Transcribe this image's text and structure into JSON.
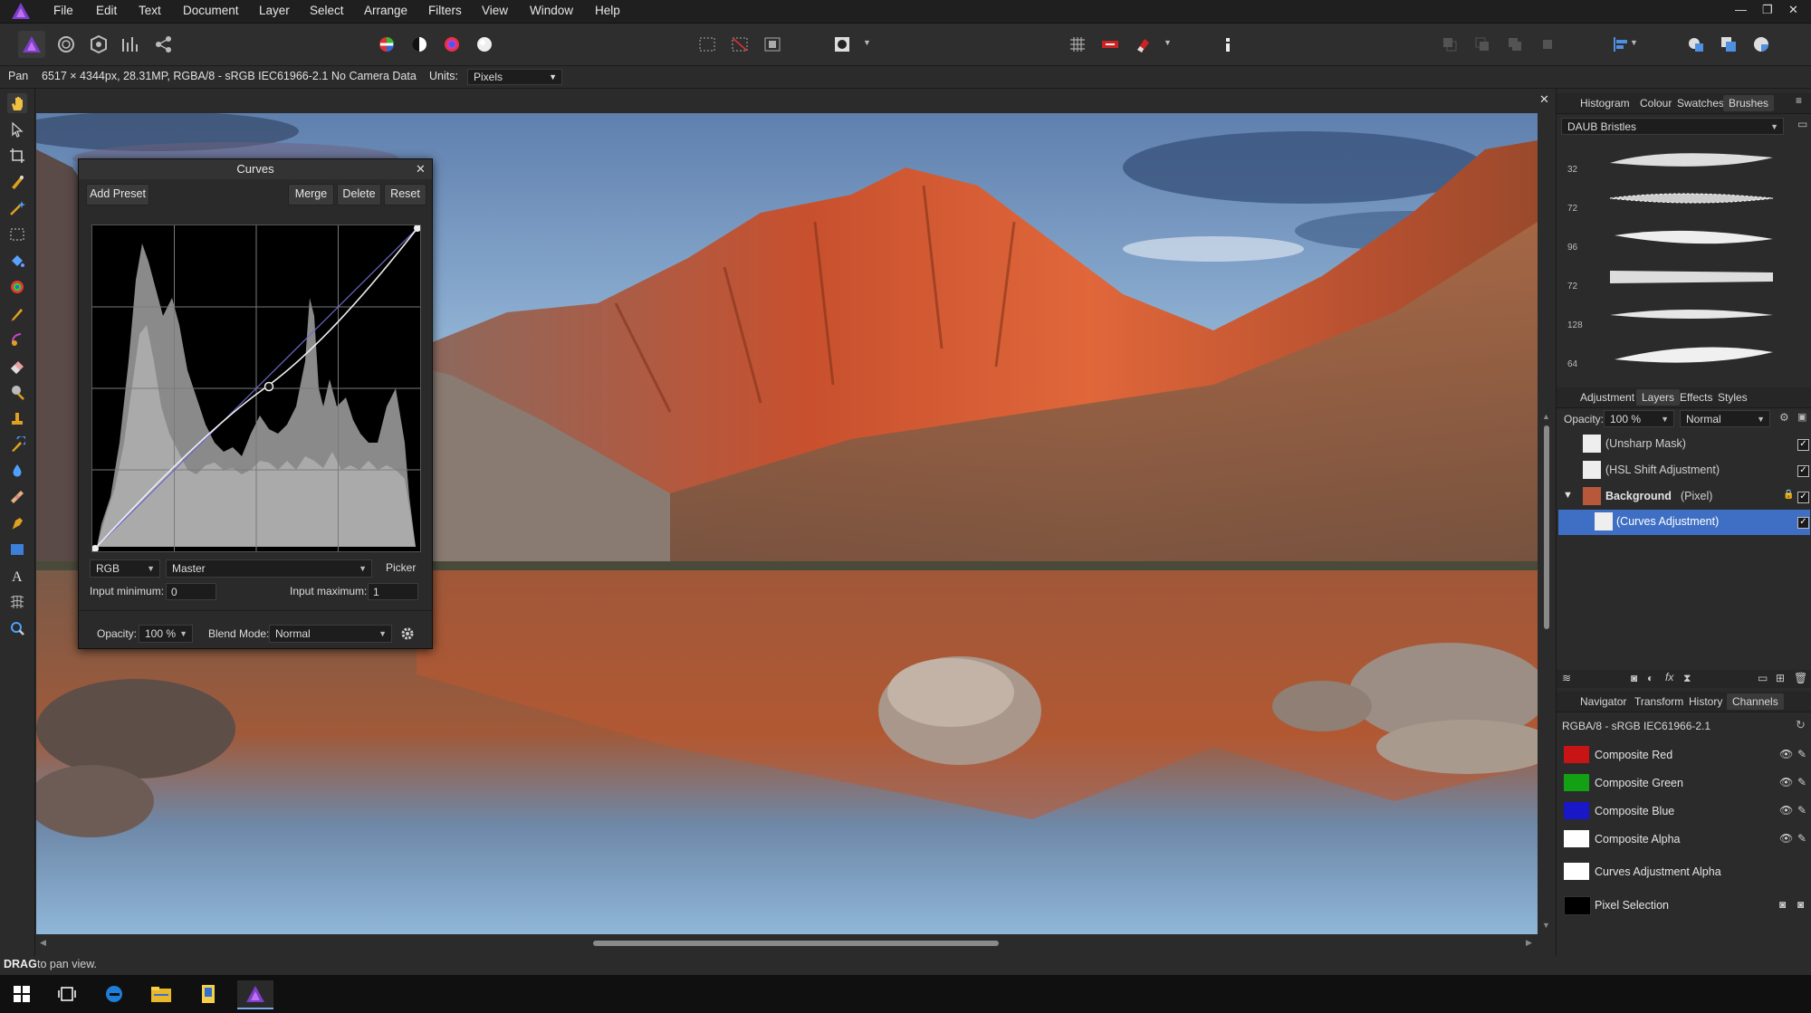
{
  "menubar": {
    "items": [
      "File",
      "Edit",
      "Text",
      "Document",
      "Layer",
      "Select",
      "Arrange",
      "Filters",
      "View",
      "Window",
      "Help"
    ],
    "window_controls": [
      "—",
      "❐",
      "✕"
    ]
  },
  "contextbar": {
    "tool": "Pan",
    "image_info": "6517 × 4344px, 28.31MP, RGBA/8 - sRGB IEC61966-2.1",
    "camera": "No Camera Data",
    "units_label": "Units:",
    "units_value": "Pixels"
  },
  "curves_dialog": {
    "title": "Curves",
    "add_preset": "Add Preset",
    "merge": "Merge",
    "delete": "Delete",
    "reset": "Reset",
    "color_space": "RGB",
    "channel": "Master",
    "picker": "Picker",
    "input_min_label": "Input minimum:",
    "input_min_value": "0",
    "input_max_label": "Input maximum:",
    "input_max_value": "1",
    "opacity_label": "Opacity:",
    "opacity_value": "100 %",
    "blend_label": "Blend Mode:",
    "blend_value": "Normal"
  },
  "brushes_panel": {
    "tabs": [
      "Histogram",
      "Colour",
      "Swatches",
      "Brushes"
    ],
    "active_tab": "Brushes",
    "category": "DAUB Bristles",
    "brush_sizes": [
      "32",
      "72",
      "96",
      "72",
      "128",
      "64"
    ]
  },
  "layers_panel": {
    "tabs": [
      "Adjustment",
      "Layers",
      "Effects",
      "Styles"
    ],
    "active_tab": "Layers",
    "opacity_label": "Opacity:",
    "opacity_value": "100 %",
    "blend_value": "Normal",
    "layers": [
      {
        "name": "(Unsharp Mask)",
        "checked": true
      },
      {
        "name": "(HSL Shift Adjustment)",
        "checked": true
      },
      {
        "name": "Background",
        "suffix": "(Pixel)",
        "checked": true
      },
      {
        "name": "(Curves Adjustment)",
        "checked": true,
        "selected": true
      }
    ]
  },
  "channels_panel": {
    "tabs": [
      "Navigator",
      "Transform",
      "History",
      "Channels"
    ],
    "active_tab": "Channels",
    "profile": "RGBA/8 - sRGB IEC61966-2.1",
    "channels": [
      {
        "name": "Composite Red",
        "color": "#c81414"
      },
      {
        "name": "Composite Green",
        "color": "#14a014"
      },
      {
        "name": "Composite Blue",
        "color": "#1818c8"
      },
      {
        "name": "Composite Alpha",
        "color": "#ffffff"
      },
      {
        "name": "Curves Adjustment Alpha",
        "color": "#ffffff"
      },
      {
        "name": "Pixel Selection",
        "color": "#000000"
      }
    ]
  },
  "status": {
    "bold": "DRAG",
    "text": " to pan view."
  },
  "colors": {
    "accent": "#3b6fc9",
    "selected_row": "#3f6fc4"
  }
}
